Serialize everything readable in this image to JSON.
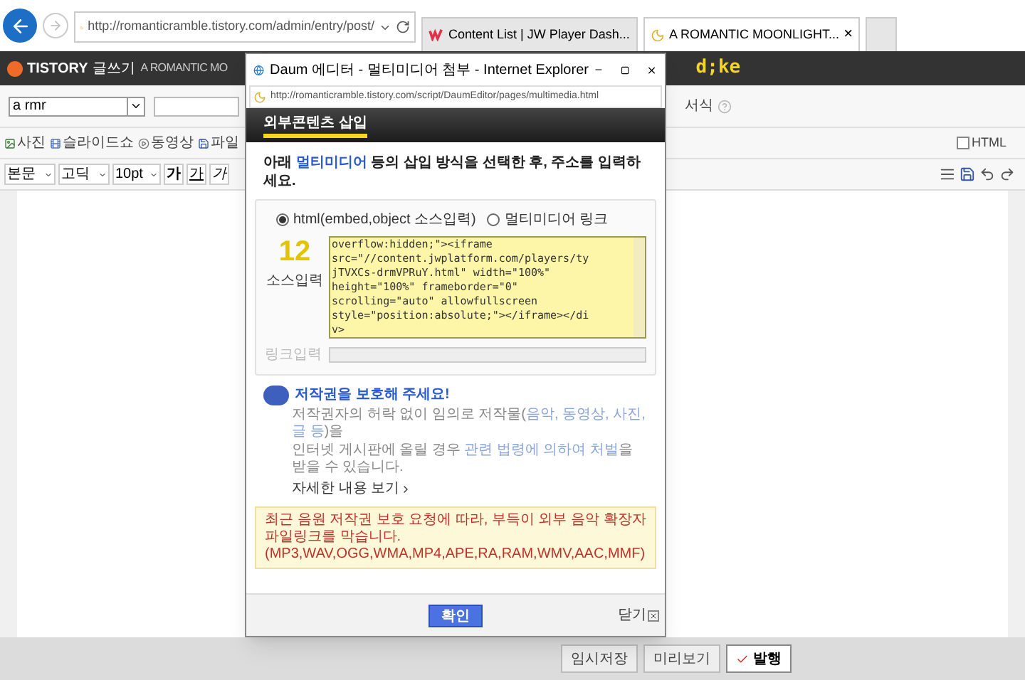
{
  "browser": {
    "address": "http://romanticramble.tistory.com/admin/entry/post/",
    "tabs": [
      {
        "label": "Content List | JW Player Dash...",
        "selected": false
      },
      {
        "label": "A ROMANTIC MOONLIGHT...",
        "selected": true,
        "close": "×"
      }
    ]
  },
  "site_bar": {
    "logo": "TISTORY",
    "section": "글쓰기",
    "blog_title": "A ROMANTIC MO",
    "user": "d;ke"
  },
  "editor": {
    "category": "a rmr",
    "format_option": "서식",
    "html_toggle": {
      "label": "HTML",
      "checked": false
    },
    "insert_tools": [
      "사진",
      "슬라이드쇼",
      "동영상",
      "파일"
    ],
    "paragraph_style": "본문",
    "font": "고딕",
    "size": "10pt",
    "style_buttons": [
      {
        "kind": "bold",
        "label": "가"
      },
      {
        "kind": "underline",
        "label": "가"
      },
      {
        "kind": "italic",
        "label": "가"
      }
    ]
  },
  "popup": {
    "title": "Daum 에디터 - 멀티미디어 첨부 - Internet Explorer",
    "address": "http://romanticramble.tistory.com/script/DaumEditor/pages/multimedia.html",
    "header": "외부콘텐츠 삽입",
    "instruction": [
      {
        "text": "아래 ",
        "highlight": false
      },
      {
        "text": "멀티미디어",
        "highlight": true
      },
      {
        "text": " 등의 삽입 방식을 선택한 후, 주소를 입력하세요.",
        "highlight": false
      }
    ],
    "modes": [
      {
        "label": "html(embed,object 소스입력)",
        "selected": true
      },
      {
        "label": "멀티미디어 링크",
        "selected": false
      }
    ],
    "annotation": "12",
    "source_label": "소스입력",
    "source_lines": [
      "overflow:hidden;\"><iframe",
      "src=\"//content.jwplatform.com/players/ty",
      "jTVXCs-drmVPRuY.html\" width=\"100%\"",
      "height=\"100%\" frameborder=\"0\"",
      "scrolling=\"auto\" allowfullscreen",
      "style=\"position:absolute;\"></iframe></di",
      "v>"
    ],
    "link_label": "링크입력",
    "link_disabled": true,
    "copyright_title": "저작권을 보호해 주세요!",
    "copyright_text": [
      [
        {
          "text": "저작권자의 허락 없이 임의로 저작물(",
          "highlight": false
        },
        {
          "text": "음악, 동영상, 사진, 글 등",
          "highlight": true
        },
        {
          "text": ")을",
          "highlight": false
        }
      ],
      [
        {
          "text": "인터넷 게시판에 올릴 경우 ",
          "highlight": false
        },
        {
          "text": "관련 법령에 의하여 처벌",
          "highlight": true
        },
        {
          "text": "을 받을 수 있습니다.",
          "highlight": false
        }
      ]
    ],
    "details_link": "자세한 내용 보기",
    "notice": [
      "최근 음원 저작권 보호 요청에 따라, 부득이 외부 음악 확장자 파일링크를 막습니다.",
      "(MP3,WAV,OGG,WMA,MP4,APE,RA,RAM,WMV,AAC,MMF)"
    ],
    "confirm": "확인",
    "close": "닫기"
  },
  "footer": [
    {
      "label": "임시저장",
      "kind": "plain"
    },
    {
      "label": "미리보기",
      "kind": "plain"
    },
    {
      "label": "발행",
      "kind": "publish"
    }
  ]
}
